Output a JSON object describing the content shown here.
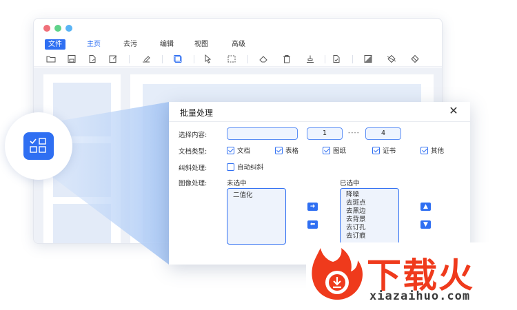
{
  "menu": {
    "items": [
      {
        "label": "文件",
        "state": "file"
      },
      {
        "label": "主页",
        "state": "active"
      },
      {
        "label": "去污",
        "state": ""
      },
      {
        "label": "编辑",
        "state": ""
      },
      {
        "label": "视图",
        "state": ""
      },
      {
        "label": "高级",
        "state": ""
      }
    ]
  },
  "toolbar": {
    "icons": [
      "open-folder-icon",
      "save-icon",
      "export-icon",
      "edit-doc-icon",
      "crop-icon",
      "batch-icon",
      "pointer-icon",
      "select-rect-icon",
      "eraser-icon",
      "delete-icon",
      "stamp-icon",
      "deskew-icon",
      "invert-icon",
      "diamond-icon",
      "rotate-diamond-icon"
    ]
  },
  "dialog": {
    "title": "批量处理",
    "select_content_label": "选择内容:",
    "range_from": "1",
    "range_sep": "----",
    "range_to": "4",
    "doc_type_label": "文档类型:",
    "doc_types": [
      {
        "label": "文档",
        "checked": true
      },
      {
        "label": "表格",
        "checked": true
      },
      {
        "label": "图纸",
        "checked": true
      },
      {
        "label": "证书",
        "checked": true
      },
      {
        "label": "其他",
        "checked": true
      }
    ],
    "deskew_label": "纠斜处理:",
    "auto_deskew": {
      "label": "自动纠斜",
      "checked": false
    },
    "image_process_label": "图像处理:",
    "unselected_label": "未选中",
    "selected_label": "已选中",
    "unselected_items": [
      "二值化"
    ],
    "selected_items": [
      "降噪",
      "去斑点",
      "去黑边",
      "去背景",
      "去订孔",
      "去订痕"
    ]
  },
  "watermark": {
    "brand": "下载火",
    "url": "xiazaihuo.com"
  },
  "colors": {
    "accent": "#2f6ff2",
    "beam": "#b8d2f7",
    "logo_red": "#ef3a1c"
  }
}
